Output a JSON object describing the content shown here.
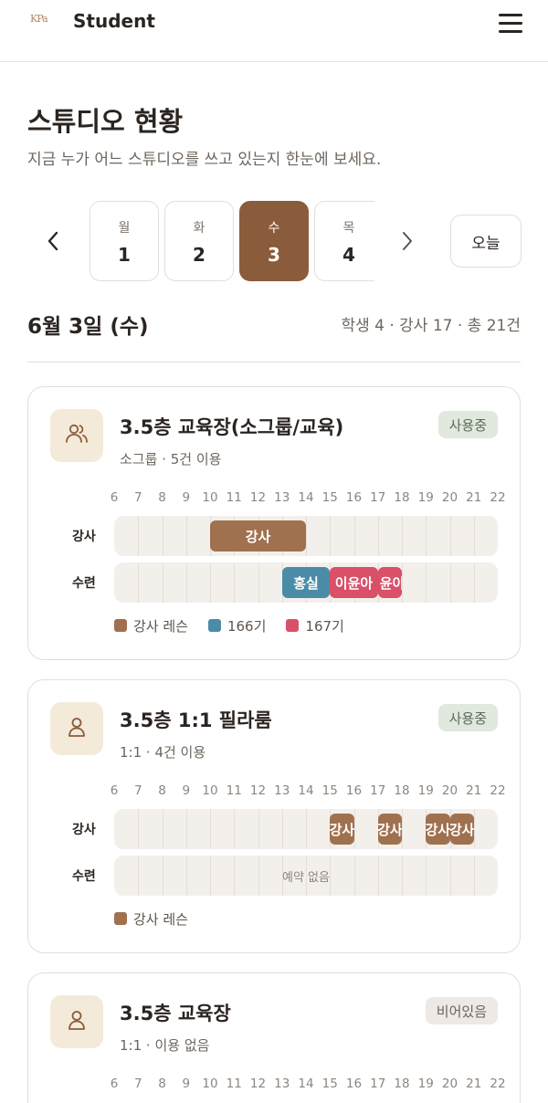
{
  "header": {
    "logo_text": "KPa",
    "app_title": "Student"
  },
  "page": {
    "title": "스튜디오 현황",
    "subtitle": "지금 누가 어느 스튜디오를 쓰고 있는지 한눈에 보세요."
  },
  "week": {
    "days": [
      {
        "dow": "월",
        "num": "1",
        "active": false
      },
      {
        "dow": "화",
        "num": "2",
        "active": false
      },
      {
        "dow": "수",
        "num": "3",
        "active": true
      },
      {
        "dow": "목",
        "num": "4",
        "active": false
      }
    ],
    "today_label": "오늘"
  },
  "summary": {
    "date": "6월 3일 (수)",
    "stats": "학생 4 · 강사 17 · 총 21건"
  },
  "hours": [
    "6",
    "7",
    "8",
    "9",
    "10",
    "11",
    "12",
    "13",
    "14",
    "15",
    "16",
    "17",
    "18",
    "19",
    "20",
    "21",
    "22"
  ],
  "colors": {
    "brown": "#a0714f",
    "teal": "#4a8ba8",
    "red": "#d95068",
    "active_day": "#8a5c3c"
  },
  "studios": [
    {
      "title": "3.5층 교육장(소그룹/교육)",
      "subtitle": "소그룹 · 5건 이용",
      "badge": "사용중",
      "badge_type": "inuse",
      "icon": "users-icon",
      "instructor_label": "강사",
      "practice_label": "수련",
      "instructor_blocks": [
        {
          "label": "강사",
          "start": 10,
          "end": 14,
          "color": "#a0714f"
        }
      ],
      "practice_blocks": [
        {
          "label": "홍실",
          "start": 13,
          "end": 15,
          "color": "#4a8ba8"
        },
        {
          "label": "이윤아",
          "start": 15,
          "end": 17,
          "color": "#d95068"
        },
        {
          "label": "|윤아",
          "start": 17,
          "end": 18,
          "color": "#d95068"
        }
      ],
      "practice_empty": "",
      "legend": [
        {
          "label": "강사 레슨",
          "color": "#a0714f"
        },
        {
          "label": "166기",
          "color": "#4a8ba8"
        },
        {
          "label": "167기",
          "color": "#d95068"
        }
      ]
    },
    {
      "title": "3.5층 1:1 필라룸",
      "subtitle": "1:1 · 4건 이용",
      "badge": "사용중",
      "badge_type": "inuse",
      "icon": "user-icon",
      "instructor_label": "강사",
      "practice_label": "수련",
      "instructor_blocks": [
        {
          "label": "강사",
          "start": 15,
          "end": 16,
          "color": "#a0714f"
        },
        {
          "label": "강사",
          "start": 17,
          "end": 18,
          "color": "#a0714f"
        },
        {
          "label": "강사",
          "start": 19,
          "end": 20,
          "color": "#a0714f"
        },
        {
          "label": "강사",
          "start": 20,
          "end": 21,
          "color": "#a0714f"
        }
      ],
      "practice_blocks": [],
      "practice_empty": "예약 없음",
      "legend": [
        {
          "label": "강사 레슨",
          "color": "#a0714f"
        }
      ]
    },
    {
      "title": "3.5층 교육장",
      "subtitle": "1:1 · 이용 없음",
      "badge": "비어있음",
      "badge_type": "empty",
      "icon": "user-icon"
    }
  ]
}
